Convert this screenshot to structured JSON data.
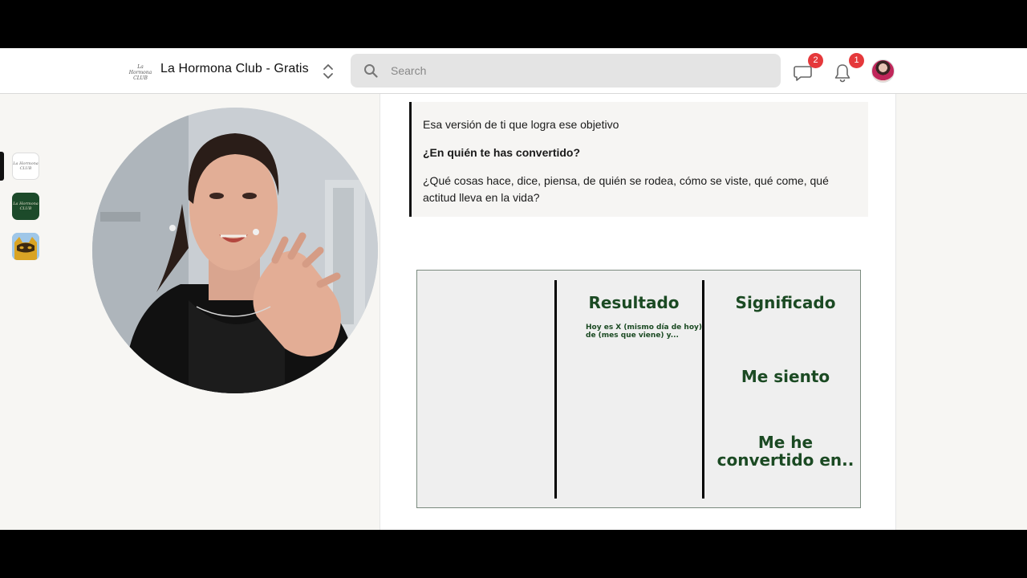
{
  "header": {
    "community_name": "La Hormona Club - Gratis",
    "logo_text": "La Hormona CLUB",
    "search_placeholder": "Search",
    "chat_badge": "2",
    "notifications_badge": "1"
  },
  "sidebar": {
    "communities": [
      {
        "name": "la-hormona-club-gratis",
        "logo_text": "La Hormona CLUB"
      },
      {
        "name": "la-hormona-club",
        "logo_text": "La Hormona CLUB"
      },
      {
        "name": "cat-community",
        "logo_text": ""
      }
    ]
  },
  "post": {
    "quote_lines": [
      "Esa versión de ti que logra ese objetivo",
      "¿En quién te has convertido?",
      "¿Qué cosas hace, dice, piensa, de quién se rodea, cómo se viste, qué come, qué actitud lleva en la vida?"
    ]
  },
  "slide": {
    "col2_title": "Resultado",
    "col2_note_1": "Hoy es X (mismo día de hoy)",
    "col2_note_2": "de (mes que viene) y...",
    "col3_title": "Significado",
    "col3_row2": "Me siento",
    "col3_row3_a": "Me he",
    "col3_row3_b": "convertido en.."
  },
  "colors": {
    "badge": "#e5383b",
    "slide_text": "#1b4a23",
    "slide_bg": "#efefef"
  }
}
